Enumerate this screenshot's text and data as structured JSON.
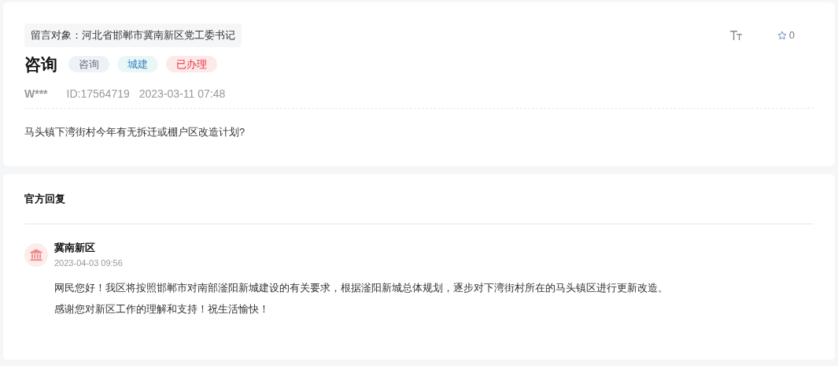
{
  "message": {
    "recipient": "留言对象：河北省邯郸市冀南新区党工委书记",
    "title": "咨询",
    "tags": [
      {
        "label": "咨询",
        "kind": "type"
      },
      {
        "label": "城建",
        "kind": "category"
      },
      {
        "label": "已办理",
        "kind": "status"
      }
    ],
    "favorites": "0",
    "author": "W***",
    "id": "ID:17564719",
    "time": "2023-03-11 07:48",
    "body": "马头镇下湾街村今年有无拆迁或棚户区改造计划?"
  },
  "reply": {
    "heading": "官方回复",
    "org": "冀南新区",
    "time": "2023-04-03 09:56",
    "lines": [
      "网民您好！我区将按照邯郸市对南部滏阳新城建设的有关要求，根据滏阳新城总体规划，逐步对下湾街村所在的马头镇区进行更新改造。",
      "感谢您对新区工作的理解和支持！祝生活愉快！"
    ]
  }
}
